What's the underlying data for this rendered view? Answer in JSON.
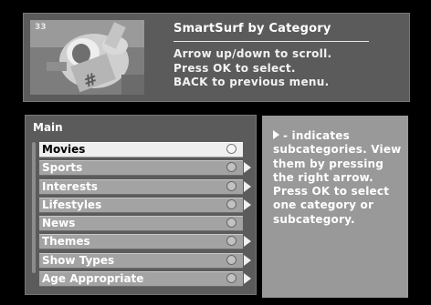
{
  "header": {
    "title": "SmartSurf by Category",
    "instructions": [
      "Arrow up/down to scroll.",
      "Press OK to select.",
      "BACK to previous menu."
    ],
    "preview_badge": "33"
  },
  "menu": {
    "title": "Main",
    "items": [
      {
        "label": "Movies",
        "has_submenu": false,
        "selected": true
      },
      {
        "label": "Sports",
        "has_submenu": true,
        "selected": false
      },
      {
        "label": "Interests",
        "has_submenu": true,
        "selected": false
      },
      {
        "label": "Lifestyles",
        "has_submenu": true,
        "selected": false
      },
      {
        "label": "News",
        "has_submenu": false,
        "selected": false
      },
      {
        "label": "Themes",
        "has_submenu": true,
        "selected": false
      },
      {
        "label": "Show Types",
        "has_submenu": true,
        "selected": false
      },
      {
        "label": "Age Appropriate",
        "has_submenu": true,
        "selected": false
      }
    ]
  },
  "info": {
    "text": "- indicates subcategories. View them by pressing the right arrow. Press OK to select one category or subcategory."
  },
  "colors": {
    "background": "#000000",
    "panel": "#5b5b5b",
    "info_panel": "#999999",
    "item": "#a3a3a3",
    "selected_item": "#efefef"
  }
}
